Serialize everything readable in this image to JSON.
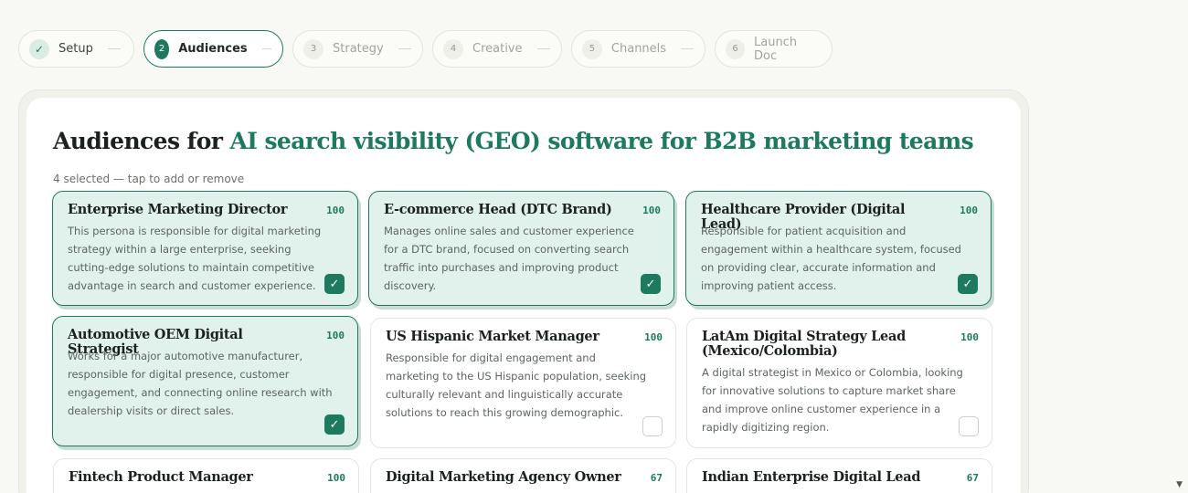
{
  "stepper": [
    {
      "num": "✓",
      "label": "Setup",
      "state": "done"
    },
    {
      "num": "2",
      "label": "Audiences",
      "state": "active"
    },
    {
      "num": "3",
      "label": "Strategy",
      "state": "todo"
    },
    {
      "num": "4",
      "label": "Creative",
      "state": "todo"
    },
    {
      "num": "5",
      "label": "Channels",
      "state": "todo"
    },
    {
      "num": "6",
      "label": "Launch Doc",
      "state": "todo"
    }
  ],
  "header": {
    "title_prefix": "Audiences for",
    "title_accent": "AI search visibility (GEO) software for B2B marketing teams",
    "subtitle": "4 selected — tap to add or remove"
  },
  "cards": [
    {
      "name": "Enterprise Marketing Director",
      "score": "100",
      "selected": true,
      "check": "✓",
      "desc": "This persona is responsible for digital marketing strategy within a large enterprise, seeking cutting-edge solutions to maintain competitive advantage in search and customer experience."
    },
    {
      "name": "E-commerce Head (DTC Brand)",
      "score": "100",
      "selected": true,
      "check": "✓",
      "desc": "Manages online sales and customer experience for a DTC brand, focused on converting search traffic into purchases and improving product discovery."
    },
    {
      "name": "Healthcare Provider (Digital Lead)",
      "score": "100",
      "selected": true,
      "check": "✓",
      "desc": "Responsible for patient acquisition and engagement within a healthcare system, focused on providing clear, accurate information and improving patient access."
    },
    {
      "name": "Automotive OEM Digital Strategist",
      "score": "100",
      "selected": true,
      "check": "✓",
      "desc": "Works for a major automotive manufacturer, responsible for digital presence, customer engagement, and connecting online research with dealership visits or direct sales."
    },
    {
      "name": "US Hispanic Market Manager",
      "score": "100",
      "selected": false,
      "check": "",
      "desc": "Responsible for digital engagement and marketing to the US Hispanic population, seeking culturally relevant and linguistically accurate solutions to reach this growing demographic."
    },
    {
      "name": "LatAm Digital Strategy Lead (Mexico/Colombia)",
      "score": "100",
      "selected": false,
      "check": "",
      "desc": "A digital strategist in Mexico or Colombia, looking for innovative solutions to capture market share and improve online customer experience in a rapidly digitizing region."
    },
    {
      "name": "Fintech Product Manager",
      "score": "100",
      "selected": false,
      "check": "",
      "desc": ""
    },
    {
      "name": "Digital Marketing Agency Owner",
      "score": "67",
      "selected": false,
      "check": "",
      "desc": ""
    },
    {
      "name": "Indian Enterprise Digital Lead",
      "score": "67",
      "selected": false,
      "check": "",
      "desc": ""
    }
  ],
  "scroll_indicator": "▼"
}
